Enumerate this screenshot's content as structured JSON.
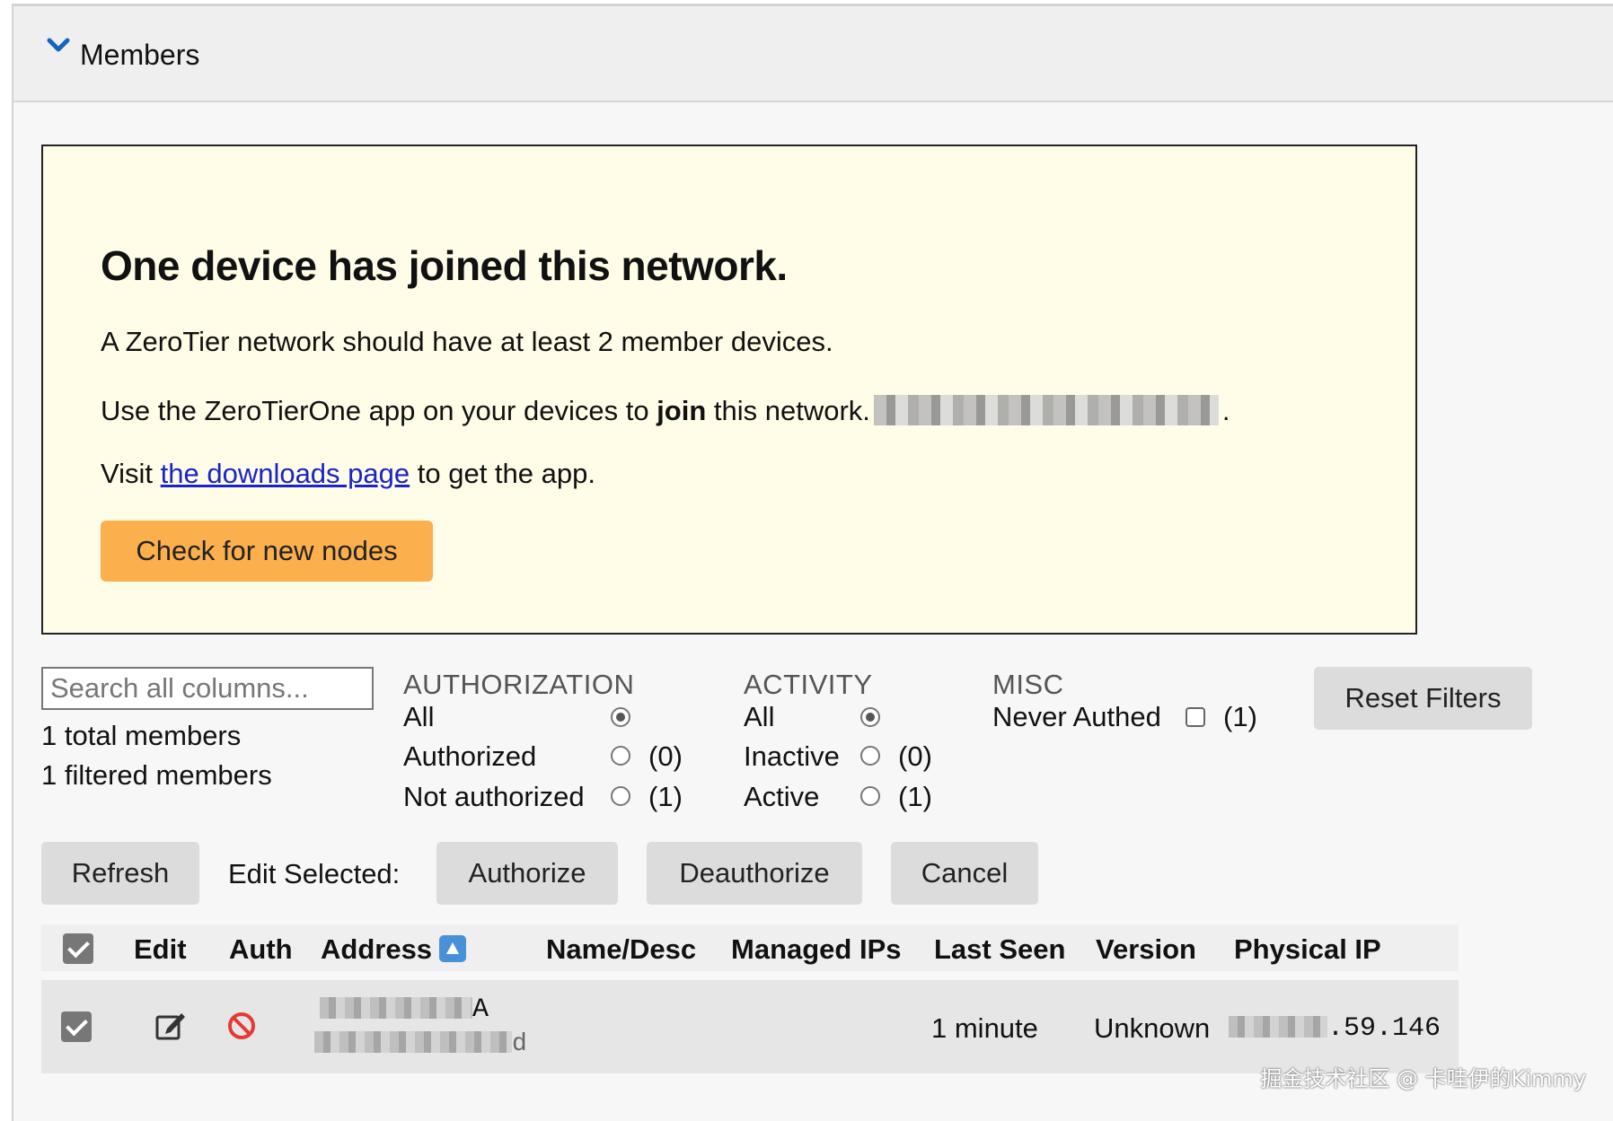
{
  "section": {
    "title": "Members",
    "icon": "chevron-down-icon"
  },
  "notice": {
    "heading": "One device has joined this network.",
    "line1": "A ZeroTier network should have at least 2 member devices.",
    "line2_pre": "Use the ZeroTierOne app on your devices to ",
    "line2_bold": "join",
    "line2_post": " this network.",
    "line2_end": ".",
    "line3_pre": "Visit ",
    "line3_link": "the downloads page",
    "line3_post": " to get the app.",
    "check_button": "Check for new nodes"
  },
  "filters": {
    "search_placeholder": "Search all columns...",
    "total": "1 total members",
    "filtered": "1 filtered members",
    "authorization": {
      "title": "AUTHORIZATION",
      "options": [
        {
          "label": "All",
          "count": "",
          "selected": true
        },
        {
          "label": "Authorized",
          "count": "(0)",
          "selected": false
        },
        {
          "label": "Not authorized",
          "count": "(1)",
          "selected": false
        }
      ]
    },
    "activity": {
      "title": "ACTIVITY",
      "options": [
        {
          "label": "All",
          "count": "",
          "selected": true
        },
        {
          "label": "Inactive",
          "count": "(0)",
          "selected": false
        },
        {
          "label": "Active",
          "count": "(1)",
          "selected": false
        }
      ]
    },
    "misc": {
      "title": "MISC",
      "never_authed": "Never Authed",
      "count": "(1)",
      "checked": false
    },
    "reset_button": "Reset Filters"
  },
  "actions": {
    "refresh": "Refresh",
    "edit_selected": "Edit Selected:",
    "authorize": "Authorize",
    "deauthorize": "Deauthorize",
    "cancel": "Cancel"
  },
  "table": {
    "columns": [
      "Edit",
      "Auth",
      "Address",
      "Name/Desc",
      "Managed IPs",
      "Last Seen",
      "Version",
      "Physical IP"
    ],
    "rows": [
      {
        "selected": true,
        "address_visible": "A",
        "mac_visible": "d",
        "last_seen": "1 minute",
        "version": "Unknown",
        "physical_ip_visible": ".59.146"
      }
    ]
  },
  "watermark": "掘金技术社区 @ 卡哇伊的Kimmy",
  "colors": {
    "notice_bg": "#fffde7",
    "accent_button": "#fbb04d",
    "link": "#1a24c9",
    "sort_icon": "#4a90d9",
    "deny_icon": "#e53935"
  }
}
